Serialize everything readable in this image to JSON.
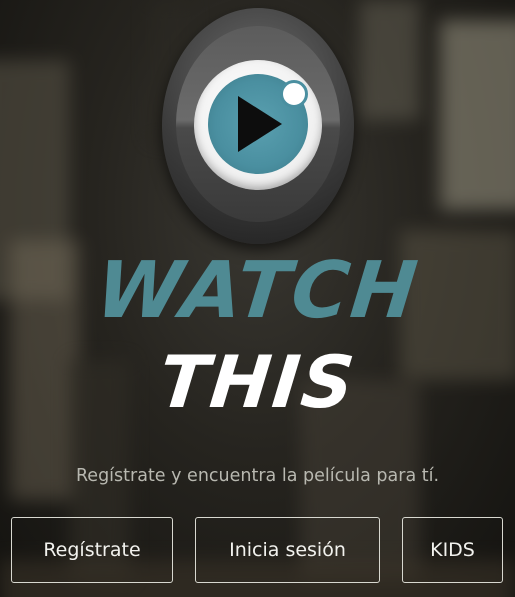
{
  "brand": {
    "word1": "WATCH",
    "word2": "THIS",
    "logo_icon": "play-eye-icon",
    "accent_color": "#4f8a93"
  },
  "tagline": "Regístrate y encuentra la película para tí.",
  "buttons": {
    "register": "Regístrate",
    "login": "Inicia sesión",
    "kids": "KIDS"
  }
}
